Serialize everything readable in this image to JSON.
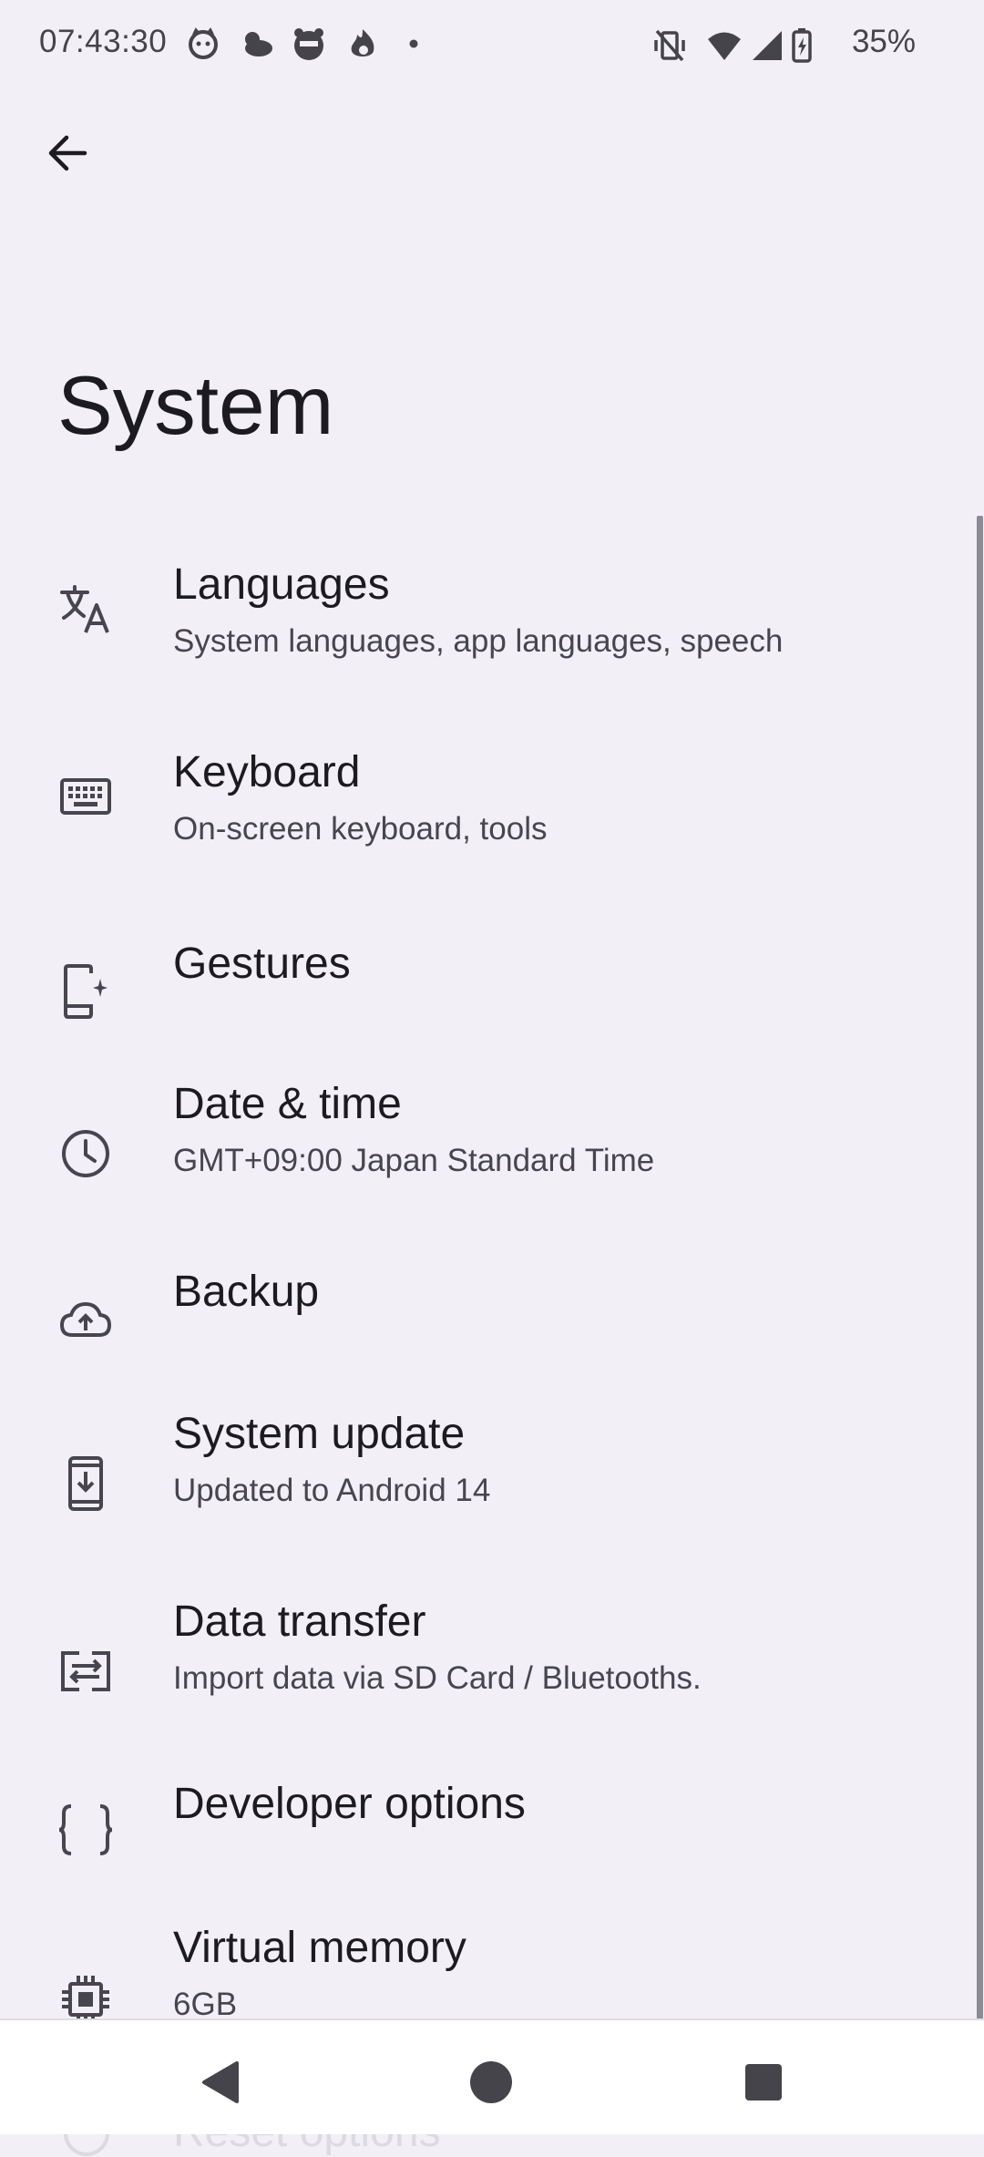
{
  "status_bar": {
    "time": "07:43:30",
    "battery": "35%",
    "notification_icons": [
      "cat-face-icon",
      "weather-cloud-icon",
      "app-badge-icon",
      "flame-app-icon",
      "more-dot-icon"
    ],
    "system_icons": [
      "vibrate-off-icon",
      "wifi-icon",
      "cellular-signal-icon",
      "battery-charging-icon"
    ]
  },
  "header": {
    "back_icon": "arrow-back-icon",
    "title": "System"
  },
  "items": [
    {
      "icon": "translate-icon",
      "title": "Languages",
      "subtitle": "System languages, app languages, speech"
    },
    {
      "icon": "keyboard-icon",
      "title": "Keyboard",
      "subtitle": "On-screen keyboard, tools"
    },
    {
      "icon": "gestures-icon",
      "title": "Gestures",
      "subtitle": ""
    },
    {
      "icon": "clock-icon",
      "title": "Date & time",
      "subtitle": "GMT+09:00 Japan Standard Time"
    },
    {
      "icon": "cloud-upload-icon",
      "title": "Backup",
      "subtitle": ""
    },
    {
      "icon": "system-update-icon",
      "title": "System update",
      "subtitle": "Updated to Android 14"
    },
    {
      "icon": "data-transfer-icon",
      "title": "Data transfer",
      "subtitle": "Import data via SD Card / Bluetooths."
    },
    {
      "icon": "code-braces-icon",
      "title": "Developer options",
      "subtitle": ""
    },
    {
      "icon": "memory-chip-icon",
      "title": "Virtual memory",
      "subtitle": "6GB"
    }
  ],
  "partial_item": {
    "title": "Reset options"
  },
  "nav_bar": {
    "back": "nav-back-icon",
    "home": "nav-home-icon",
    "recents": "nav-recents-icon"
  },
  "colors": {
    "background": "#f2f0f6",
    "text_primary": "#1c1b20",
    "text_secondary": "#47464f",
    "nav_background": "#ffffff"
  }
}
